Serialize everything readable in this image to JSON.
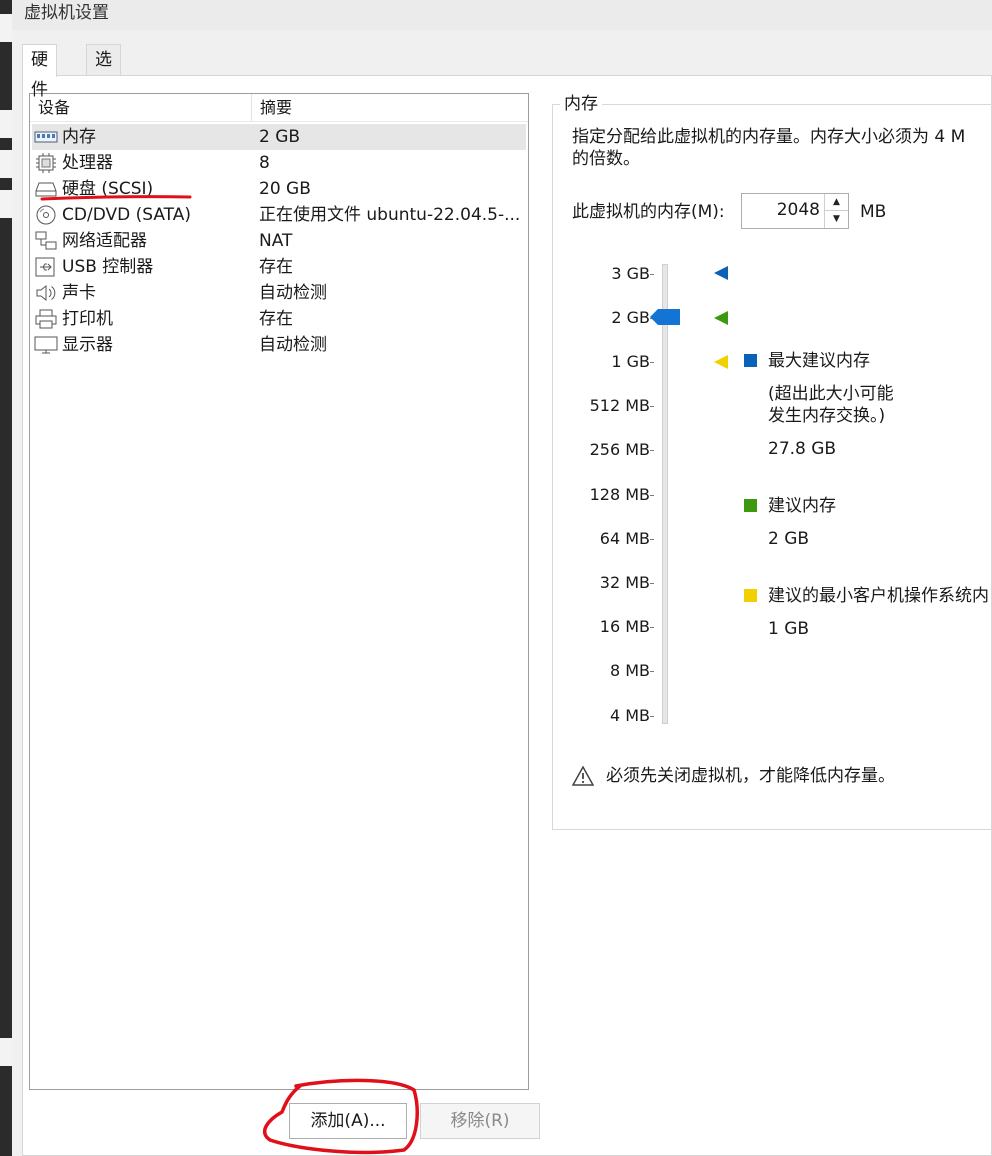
{
  "window": {
    "title": "虚拟机设置"
  },
  "tabs": [
    {
      "label": "硬件",
      "active": true
    },
    {
      "label": "选项",
      "active": false
    }
  ],
  "device_list": {
    "headers": {
      "device": "设备",
      "summary": "摘要"
    },
    "rows": [
      {
        "icon": "memory-icon",
        "name": "内存",
        "summary": "2 GB",
        "selected": true
      },
      {
        "icon": "processor-icon",
        "name": "处理器",
        "summary": "8"
      },
      {
        "icon": "hard-disk-icon",
        "name": "硬盘 (SCSI)",
        "summary": "20 GB"
      },
      {
        "icon": "cd-dvd-icon",
        "name": "CD/DVD (SATA)",
        "summary": "正在使用文件 ubuntu-22.04.5-..."
      },
      {
        "icon": "network-adapter-icon",
        "name": "网络适配器",
        "summary": "NAT"
      },
      {
        "icon": "usb-icon",
        "name": "USB 控制器",
        "summary": "存在"
      },
      {
        "icon": "sound-card-icon",
        "name": "声卡",
        "summary": "自动检测"
      },
      {
        "icon": "printer-icon",
        "name": "打印机",
        "summary": "存在"
      },
      {
        "icon": "display-icon",
        "name": "显示器",
        "summary": "自动检测"
      }
    ]
  },
  "buttons": {
    "add": "添加(A)...",
    "remove": "移除(R)"
  },
  "memory": {
    "group_title": "内存",
    "description": "指定分配给此虚拟机的内存量。内存大小必须为 4 M\n的倍数。",
    "field_label": "此虚拟机的内存(M):",
    "value": "2048",
    "unit": "MB",
    "scale_labels": [
      "3 GB",
      "2 GB",
      "1 GB",
      "512 MB",
      "256 MB",
      "128 MB",
      "64 MB",
      "32 MB",
      "16 MB",
      "8 MB",
      "4 MB"
    ],
    "legend": {
      "max": {
        "label": "最大建议内存",
        "note": "(超出此大小可能\n发生内存交换。)",
        "value": "27.8 GB",
        "color": "#0a62b8"
      },
      "recommended": {
        "label": "建议内存",
        "value": "2 GB",
        "color": "#3d9a10"
      },
      "min_guest": {
        "label": "建议的最小客户机操作系统内",
        "value": "1 GB",
        "color": "#f2d000"
      }
    },
    "warning": "必须先关闭虚拟机，才能降低内存量。"
  },
  "colors": {
    "annotation": "#e0101a",
    "slider_thumb": "#1474d4"
  }
}
